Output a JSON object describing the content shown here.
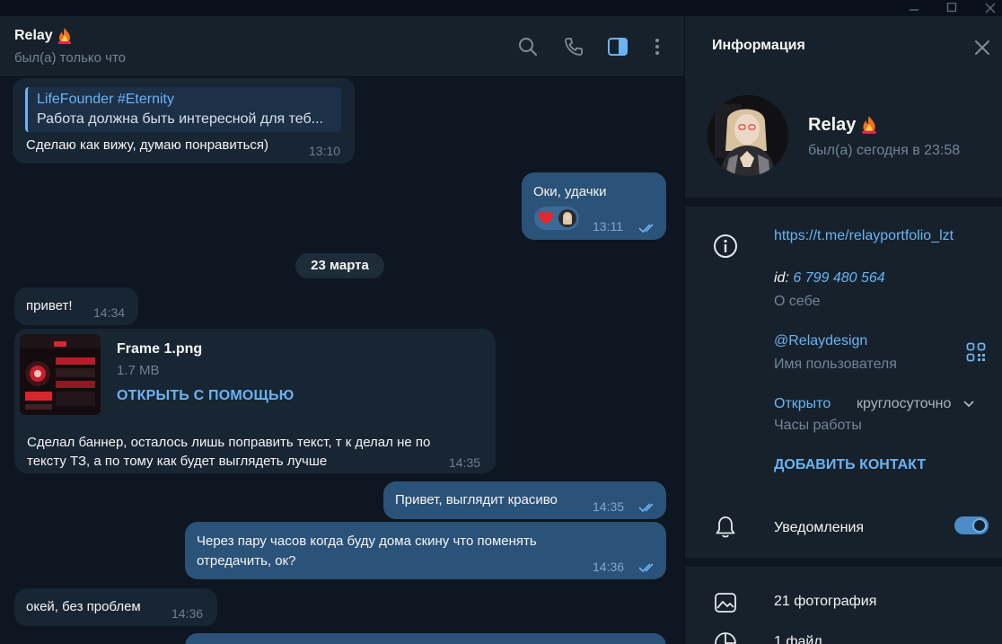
{
  "chat": {
    "peer_name": "Relay",
    "peer_status": "был(а) только что"
  },
  "messages": {
    "m1": {
      "reply_name": "LifeFounder #Eternity",
      "reply_text": "Работа должна быть интересной для теб...",
      "text": "Сделаю как вижу, думаю понравиться)",
      "time": "13:10"
    },
    "m2": {
      "text": "Оки, удачки",
      "time": "13:11"
    },
    "date_separator": "23 марта",
    "m3": {
      "text": "привет!",
      "time": "14:34"
    },
    "m4": {
      "file_name": "Frame 1.png",
      "file_size": "1.7 MB",
      "open_with": "ОТКРЫТЬ С ПОМОЩЬЮ",
      "text_line1": "Сделал баннер, осталось лишь поправить текст, т к делал не по",
      "text_line2": "тексту ТЗ, а по тому как будет выглядеть лучше",
      "time": "14:35"
    },
    "m5": {
      "text": "Привет, выглядит красиво",
      "time": "14:35"
    },
    "m6": {
      "text_line1": "Через пару часов когда буду дома скину что поменять",
      "text_line2": "отредачить, ок?",
      "time": "14:36"
    },
    "m7": {
      "text": "окей, без проблем",
      "time": "14:36"
    }
  },
  "info": {
    "title": "Информация",
    "name": "Relay",
    "status": "был(а) сегодня в 23:58",
    "link": "https://t.me/relayportfolio_lzt",
    "id_label": "id:",
    "id_value": "6 799 480 564",
    "bio_label": "О себе",
    "username": "@Relaydesign",
    "username_label": "Имя пользователя",
    "hours_open": "Открыто",
    "hours_value": "круглосуточно",
    "hours_label": "Часы работы",
    "add_contact": "ДОБАВИТЬ КОНТАКТ",
    "notifications": "Уведомления",
    "notifications_on": true,
    "photos": "21 фотография",
    "files": "1 файл"
  },
  "colors": {
    "background": "#0e1621",
    "panel": "#17212b",
    "incoming_bubble": "#182533",
    "outgoing_bubble": "#2b5278",
    "accent": "#6ab3f3",
    "muted": "#708499"
  },
  "icons": [
    "search-icon",
    "phone-icon",
    "sidebar-toggle-icon",
    "more-icon",
    "close-icon",
    "info-icon",
    "qr-code-icon",
    "bell-icon",
    "photo-icon",
    "file-icon",
    "fire-icon",
    "heart-icon",
    "double-check-icon",
    "chevron-down-icon"
  ]
}
